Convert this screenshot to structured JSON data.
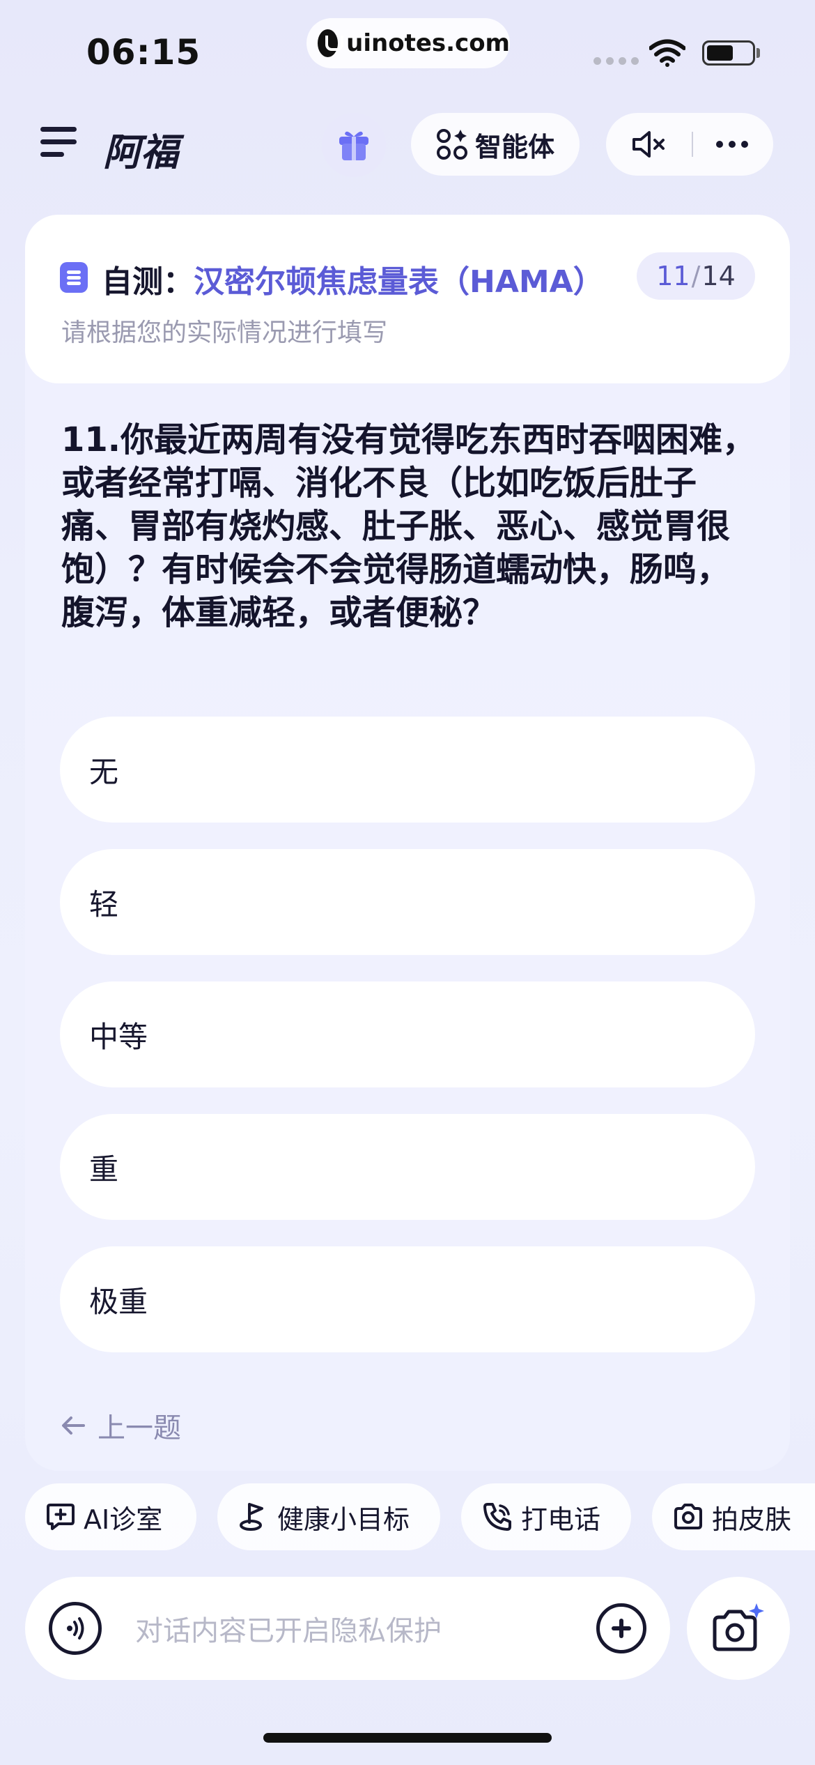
{
  "status_bar": {
    "time": "06:15",
    "url": "uinotes.com",
    "wifi_icon": "wifi-icon",
    "battery_icon": "battery-icon"
  },
  "header": {
    "title": "阿福",
    "agent_label": "智能体",
    "icons": [
      "menu-icon",
      "gift-icon",
      "agent-grid-icon",
      "speaker-mute-icon",
      "more-icon"
    ]
  },
  "survey": {
    "prefix": "自测：",
    "name": "汉密尔顿焦虑量表（HAMA）",
    "current": "11",
    "total": "14",
    "separator": "/",
    "subtitle": "请根据您的实际情况进行填写"
  },
  "question": {
    "text": "11.你最近两周有没有觉得吃东西时吞咽困难，或者经常打嗝、消化不良（比如吃饭后肚子痛、胃部有烧灼感、肚子胀、恶心、感觉胃很饱）？有时候会不会觉得肠道蠕动快，肠鸣，腹泻，体重减轻，或者便秘？"
  },
  "options": [
    "无",
    "轻",
    "中等",
    "重",
    "极重"
  ],
  "prev_label": "上一题",
  "chips": [
    {
      "label": "AI诊室",
      "icon": "chat-cross-icon"
    },
    {
      "label": "健康小目标",
      "icon": "flag-icon"
    },
    {
      "label": "打电话",
      "icon": "phone-icon"
    },
    {
      "label": "拍皮肤",
      "icon": "camera-icon"
    }
  ],
  "input": {
    "placeholder": "对话内容已开启隐私保护"
  },
  "colors": {
    "accent": "#5b5bd6",
    "background": "#eceefc",
    "card": "#ffffff"
  }
}
